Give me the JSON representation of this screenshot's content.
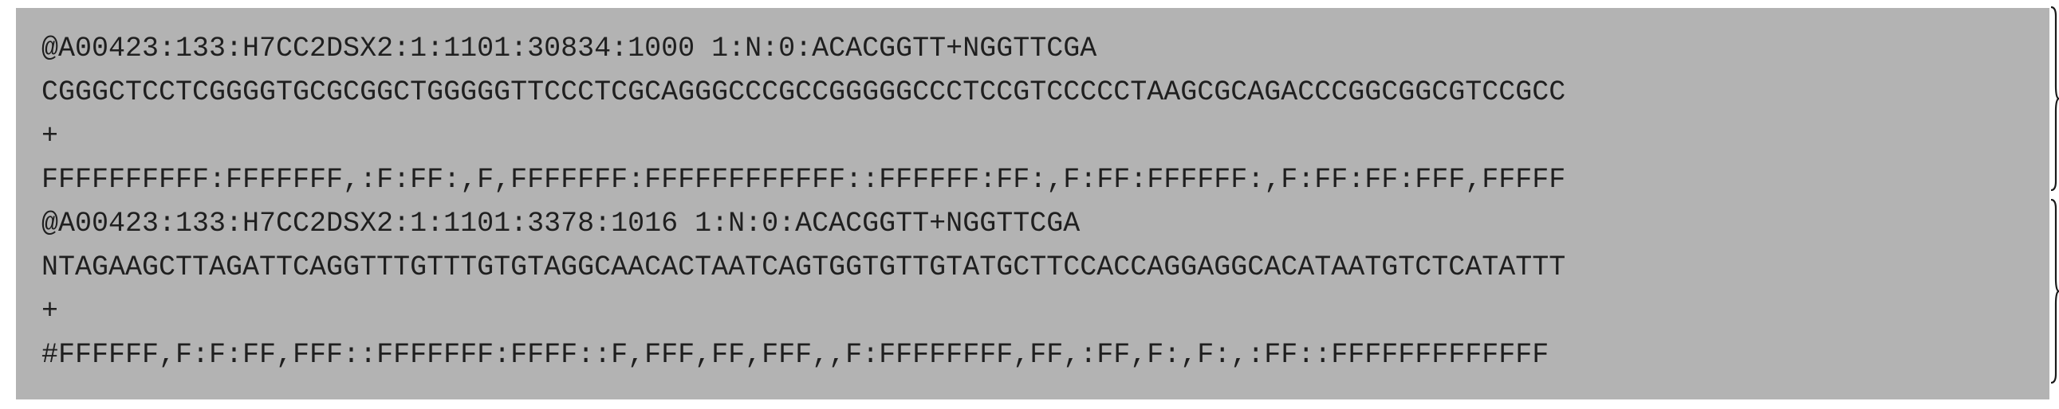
{
  "records": [
    {
      "header": "@A00423:133:H7CC2DSX2:1:1101:30834:1000 1:N:0:ACACGGTT+NGGTTCGA",
      "sequence": "CGGGCTCCTCGGGGTGCGCGGCTGGGGGTTCCCTCGCAGGGCCCGCCGGGGGCCCTCCGTCCCCCTAAGCGCAGACCCGGCGGCGTCCGCC",
      "separator": "+",
      "quality": "FFFFFFFFFF:FFFFFFF,:F:FF:,F,FFFFFFF:FFFFFFFFFFFF::FFFFFF:FF:,F:FF:FFFFFF:,F:FF:FF:FFF,FFFFF"
    },
    {
      "header": "@A00423:133:H7CC2DSX2:1:1101:3378:1016 1:N:0:ACACGGTT+NGGTTCGA",
      "sequence": "NTAGAAGCTTAGATTCAGGTTTGTTTGTGTAGGCAACACTAATCAGTGGTGTTGTATGCTTCCACCAGGAGGCACATAATGTCTCATATTT",
      "separator": "+",
      "quality": "#FFFFFF,F:F:FF,FFF::FFFFFFF:FFFF::F,FFF,FF,FFF,,F:FFFFFFFF,FF,:FF,F:,F:,:FF::FFFFFFFFFFFFF"
    }
  ],
  "colors": {
    "panel_background": "#b3b3b3",
    "text": "#1f1f1f",
    "brace": "#1a1a1a"
  }
}
